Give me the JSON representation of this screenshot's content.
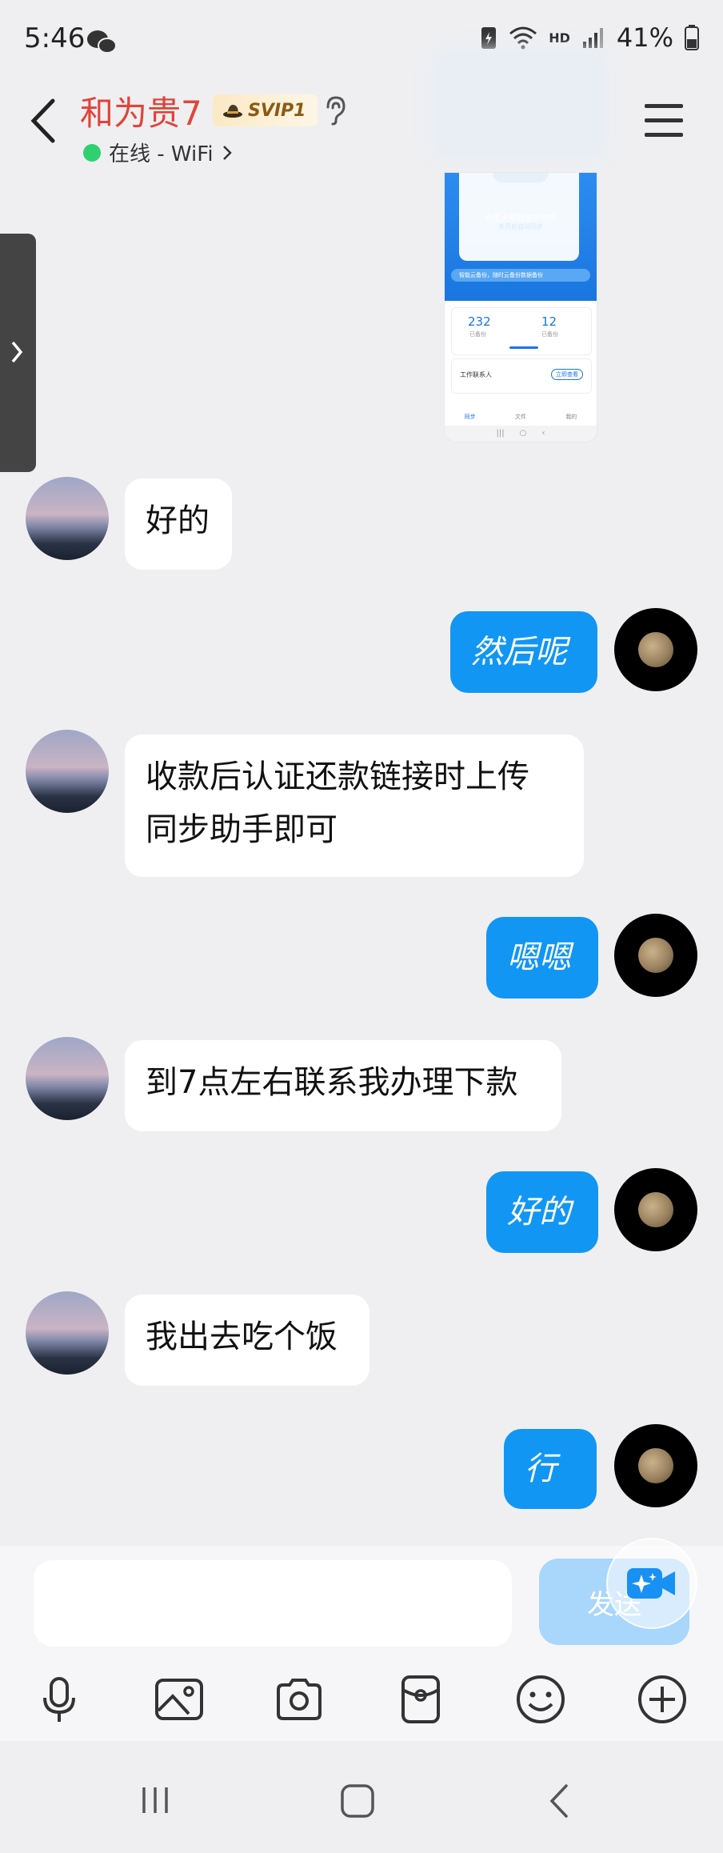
{
  "status_bar": {
    "time": "5:46",
    "network": "HD",
    "battery": "41%"
  },
  "header": {
    "contact_name": "和为贵7",
    "vip_badge": "SVIP1",
    "presence": "在线 - WiFi"
  },
  "messages": [
    {
      "side": "left",
      "text": "好的"
    },
    {
      "side": "right",
      "text": "然后呢"
    },
    {
      "side": "left",
      "text_line1": "收款后认证还款链接时上传",
      "text_line2": "同步助手即可"
    },
    {
      "side": "right",
      "text": "嗯嗯"
    },
    {
      "side": "left",
      "text": "到7点左右联系我办理下款"
    },
    {
      "side": "right",
      "text": "好的"
    },
    {
      "side": "left",
      "text": "我出去吃个饭"
    },
    {
      "side": "right",
      "text": "行"
    }
  ],
  "shared_image": {
    "line1": "点击大按钮进行同步",
    "line2": "未开启自动同步",
    "notice": "智能云备份，随时云备份数据备份",
    "stat1_value": "232",
    "stat1_label": "已备份",
    "stat2_value": "12",
    "stat2_label": "已备份",
    "contacts_label": "工作联系人",
    "contacts_btn": "立即查看",
    "nav1": "同步",
    "nav2": "文件",
    "nav3": "我的"
  },
  "input": {
    "send_label": "发送"
  },
  "colors": {
    "accent": "#1296f4",
    "name_red": "#e0443a",
    "online_green": "#2fd06f"
  }
}
